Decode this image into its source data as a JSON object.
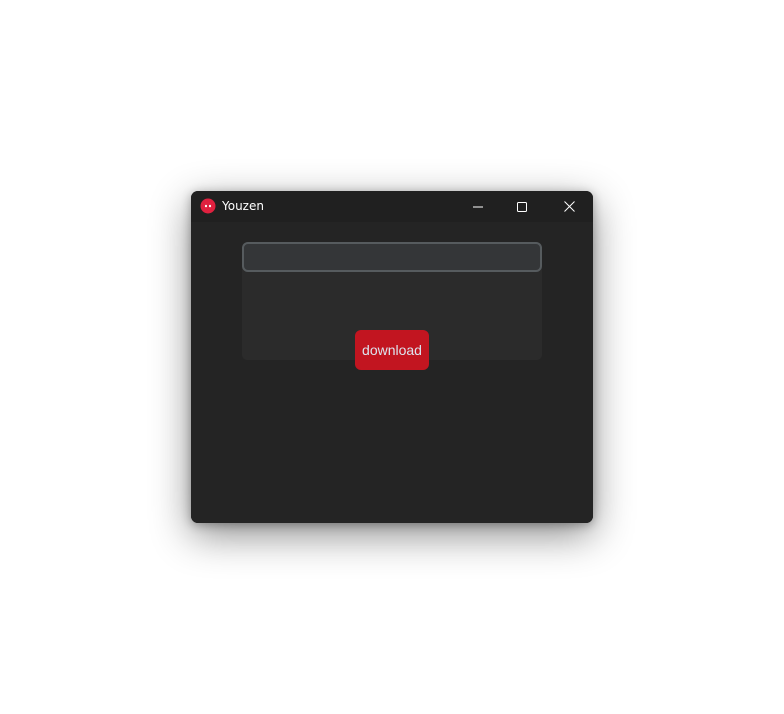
{
  "window": {
    "title": "Youzen",
    "icon": "ghost-app-icon",
    "controls": {
      "minimize_icon": "minimize-icon",
      "maximize_icon": "maximize-icon",
      "close_icon": "close-icon"
    }
  },
  "form": {
    "url_input": {
      "value": "",
      "placeholder": ""
    },
    "download_label": "download"
  },
  "colors": {
    "window_bg": "#242424",
    "titlebar_bg": "#202020",
    "panel_bg": "#2b2b2b",
    "input_bg": "#343638",
    "input_border": "#565b5e",
    "accent": "#c21520",
    "app_icon": "#e0213f",
    "text": "#dce4ee"
  }
}
